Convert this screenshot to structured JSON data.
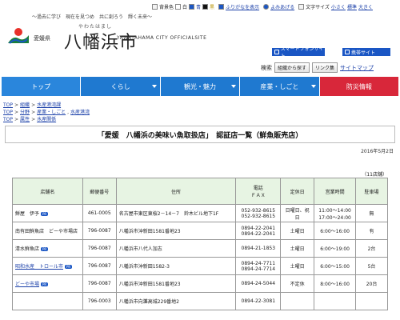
{
  "utility_bar": {
    "bg_label": "背景色",
    "bg_options": [
      "白",
      "青",
      "黒"
    ],
    "furigana": "ふりがなを表示",
    "yomiage": "よみあげる",
    "font_size_label": "文字サイズ",
    "font_sizes": [
      "小さく",
      "標準",
      "大きく"
    ]
  },
  "header": {
    "tagline": "～過去に学び　現在を見つめ　共に創ろう　輝く未来～",
    "prefecture": "愛媛県",
    "city_ruby": "やわたはまし",
    "city_name": "八幡浜市",
    "city_en": "YAWATAHAMA CITY OFFICIALSITE",
    "smartphone_label": "スマートフォンサイト",
    "mobile_label": "携帯サイト"
  },
  "search": {
    "label": "検索",
    "org_button": "組織から探す",
    "link_button": "リンク集",
    "sitemap": "サイトマップ"
  },
  "nav": {
    "tabs": [
      "トップ",
      "くらし",
      "観光・魅力",
      "産業・しごと",
      "防災情報"
    ]
  },
  "breadcrumbs": [
    [
      "TOP",
      "組織",
      "水産港湾課"
    ],
    [
      "TOP",
      "分野",
      "産業・しごと",
      "水産港湾"
    ],
    [
      "TOP",
      "属性",
      "水産関係"
    ]
  ],
  "page": {
    "title": "「愛媛　八幡浜の美味い魚取扱店」　認証店一覧（鮮魚販売店）",
    "date": "2016年5月2日",
    "count": "（11店舗）"
  },
  "table": {
    "headers": [
      "店舗名",
      "郵便番号",
      "住所",
      "電話\nＦＡＸ",
      "定休日",
      "営業時間",
      "駐車場"
    ],
    "rows": [
      {
        "name": "鮮屋　伊予",
        "link": false,
        "badge": true,
        "zip": "461-0005",
        "address": "名古屋市東区東桜2－14－7　鈴木ビル地下1F",
        "tel": "052-932-8615",
        "fax": "052-932-8615",
        "closed": "日曜日、祝日",
        "hours": "11:00～14:00\n17:00～24:00",
        "parking": "無"
      },
      {
        "name": "南有田鮮魚店　どーや市場店",
        "link": false,
        "badge": false,
        "zip": "796-0087",
        "address": "八幡浜市沖新田1581番地23",
        "tel": "0894-22-2041",
        "fax": "0894-22-2041",
        "closed": "土曜日",
        "hours": "6:00～16:00",
        "parking": "有"
      },
      {
        "name": "清水鮮魚店",
        "link": false,
        "badge": true,
        "zip": "796-0087",
        "address": "八幡浜市八代人加志",
        "tel": "0894-21-1853",
        "fax": "",
        "closed": "土曜日",
        "hours": "6:00～19:00",
        "parking": "2台"
      },
      {
        "name": "昭和水産　トロール市",
        "link": true,
        "badge": true,
        "zip": "796-0087",
        "address": "八幡浜市沖新田1582-3",
        "tel": "0894-24-7711",
        "fax": "0894-24-7714",
        "closed": "土曜日",
        "hours": "6:00～15:00",
        "parking": "5台"
      },
      {
        "name": "どーや市場",
        "link": true,
        "badge": true,
        "zip": "796-0087",
        "address": "八幡浜市沖新田1581番地23",
        "tel": "0894-24-5044",
        "fax": "",
        "closed": "不定休",
        "hours": "8:00～16:00",
        "parking": "20台"
      },
      {
        "name": "",
        "link": false,
        "badge": false,
        "zip": "796-0003",
        "address": "八幡浜市向灘高城229番地2",
        "tel": "0894-22-3081",
        "fax": "",
        "closed": "",
        "hours": "",
        "parking": ""
      }
    ]
  }
}
